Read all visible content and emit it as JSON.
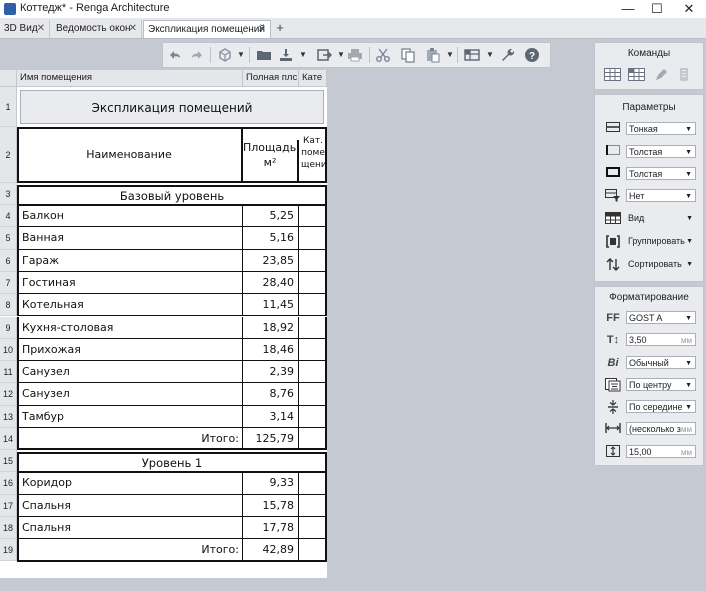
{
  "window": {
    "title": "Коттедж* - Renga Architecture",
    "minimize": "—",
    "maximize": "☐",
    "close": "✕"
  },
  "tabs": [
    {
      "label": "3D Вид",
      "close": "✕"
    },
    {
      "label": "Ведомость окон",
      "close": "✕"
    },
    {
      "label": "Экспликация помещений",
      "close": "✕"
    }
  ],
  "tab_add": "+",
  "toolbar": {
    "icons": [
      "undo-icon",
      "redo-icon",
      "view-3d-icon",
      "folder-open-icon",
      "save-icon",
      "export-icon",
      "print-icon",
      "cut-icon",
      "copy-icon",
      "paste-icon",
      "table-settings-icon",
      "wrench-icon",
      "help-icon"
    ]
  },
  "sheet": {
    "column_headers": [
      "Имя помещения",
      "Полная плс",
      "Кате"
    ],
    "row_numbers": [
      "1",
      "2",
      "3",
      "4",
      "5",
      "6",
      "7",
      "8",
      "9",
      "10",
      "11",
      "12",
      "13",
      "14",
      "15",
      "16",
      "17",
      "18",
      "19"
    ],
    "table_title": "Экспликация помещений",
    "header_name": "Наименование",
    "header_area": "Площадь, м²",
    "header_area_line1": "Площадь,",
    "header_area_line2": "м²",
    "header_cat_l1": "Кат.",
    "header_cat_l2": "поме",
    "header_cat_l3": "щения",
    "groups": [
      {
        "title": "Базовый уровень",
        "rows": [
          {
            "name": "Балкон",
            "area": "5,25"
          },
          {
            "name": "Ванная",
            "area": "5,16"
          },
          {
            "name": "Гараж",
            "area": "23,85"
          },
          {
            "name": "Гостиная",
            "area": "28,40"
          },
          {
            "name": "Котельная",
            "area": "11,45"
          },
          {
            "name": "Кухня-столовая",
            "area": "18,92"
          },
          {
            "name": "Прихожая",
            "area": "18,46"
          },
          {
            "name": "Санузел",
            "area": "2,39"
          },
          {
            "name": "Санузел",
            "area": "8,76"
          },
          {
            "name": "Тамбур",
            "area": "3,14"
          }
        ],
        "total_label": "Итого:",
        "total": "125,79"
      },
      {
        "title": "Уровень 1",
        "rows": [
          {
            "name": "Коридор",
            "area": "9,33"
          },
          {
            "name": "Спальня",
            "area": "15,78"
          },
          {
            "name": "Спальня",
            "area": "17,78"
          }
        ],
        "total_label": "Итого:",
        "total": "42,89"
      }
    ]
  },
  "panels": {
    "commands": {
      "title": "Команды"
    },
    "parameters": {
      "title": "Параметры",
      "items": [
        {
          "icon": "line-thin-icon",
          "value": "Тонкая"
        },
        {
          "icon": "border-side-icon",
          "value": "Толстая"
        },
        {
          "icon": "border-all-icon",
          "value": "Толстая"
        },
        {
          "icon": "filter-icon",
          "value": "Нет"
        },
        {
          "icon": "table-view-icon",
          "value": "Вид"
        },
        {
          "icon": "group-icon",
          "value": "Группировать"
        },
        {
          "icon": "sort-icon",
          "value": "Сортировать"
        }
      ]
    },
    "formatting": {
      "title": "Форматирование",
      "font": "GOST A",
      "size": "3,50",
      "size_unit": "мм",
      "style": "Обычный",
      "halign": "По центру",
      "valign": "По середине",
      "width": "(несколько з",
      "width_unit": "мм",
      "height": "15,00",
      "height_unit": "мм",
      "icon_font": "FF",
      "icon_size": "T↕",
      "icon_style": "Bi"
    }
  },
  "colors": {
    "background": "#c5cad2",
    "panel": "#e9ebee",
    "sheet": "#ffffff"
  }
}
